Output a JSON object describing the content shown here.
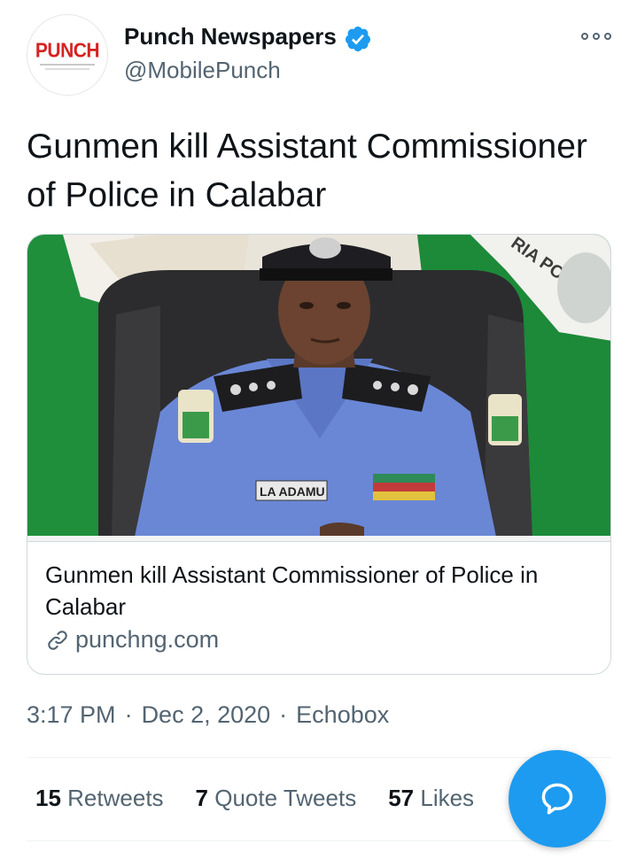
{
  "author": {
    "display_name": "Punch Newspapers",
    "handle": "@MobilePunch",
    "verified": true,
    "avatar_logo_text": "PUNCH"
  },
  "tweet": {
    "text": "Gunmen kill Assistant Commissioner of Police in Calabar"
  },
  "card": {
    "image_badge_text": "LA ADAMU",
    "image_flag_text": "RIA POLICE",
    "title": "Gunmen kill Assistant Commissioner of Police in Calabar",
    "domain": "punchng.com"
  },
  "meta": {
    "time": "3:17 PM",
    "separator": "·",
    "date": "Dec 2, 2020",
    "source": "Echobox"
  },
  "stats": {
    "retweets": {
      "count": "15",
      "label": "Retweets"
    },
    "quote_tweets": {
      "count": "7",
      "label": "Quote Tweets"
    },
    "likes": {
      "count": "57",
      "label": "Likes"
    }
  },
  "icons": {
    "verified": "verified-badge-icon",
    "more": "more-options-icon",
    "link": "link-icon",
    "reply_fab": "reply-bubble-icon"
  },
  "colors": {
    "accent": "#1d9bf0",
    "brand_red": "#d62222",
    "secondary_text": "#536471",
    "border": "#cfd9de"
  }
}
